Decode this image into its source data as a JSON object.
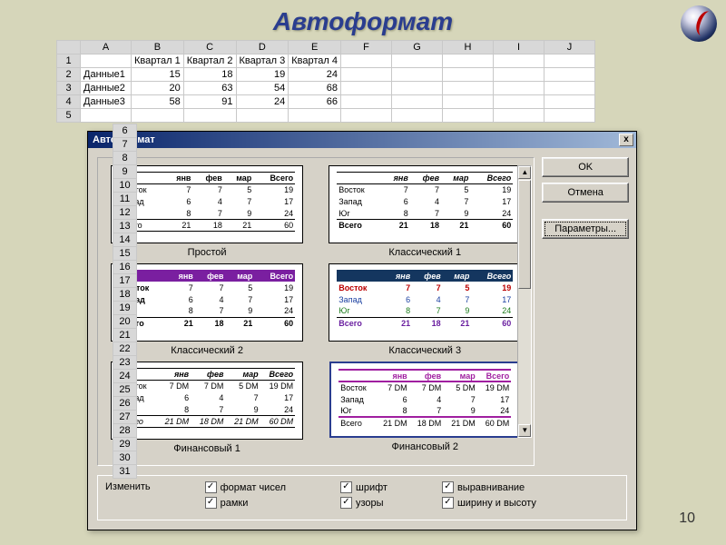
{
  "slide": {
    "title": "Автоформат",
    "number": "10"
  },
  "sheet": {
    "cols": [
      "A",
      "B",
      "C",
      "D",
      "E",
      "F",
      "G",
      "H",
      "I",
      "J"
    ],
    "row1": {
      "a": "",
      "b": "Квартал 1",
      "c": "Квартал 2",
      "d": "Квартал 3",
      "e": "Квартал 4"
    },
    "row2": {
      "a": "Данные1",
      "b": "15",
      "c": "18",
      "d": "19",
      "e": "24"
    },
    "row3": {
      "a": "Данные2",
      "b": "20",
      "c": "63",
      "d": "54",
      "e": "68"
    },
    "row4": {
      "a": "Данные3",
      "b": "58",
      "c": "91",
      "d": "24",
      "e": "66"
    }
  },
  "dialog": {
    "title": "Автоформат",
    "buttons": {
      "ok": "OK",
      "cancel": "Отмена",
      "params": "Параметры..."
    },
    "styles": {
      "s1": "Простой",
      "s2": "Классический 1",
      "s3": "Классический 2",
      "s4": "Классический 3",
      "s5": "Финансовый 1",
      "s6": "Финансовый 2"
    },
    "mini": {
      "hdr": {
        "c1": "янв",
        "c2": "фев",
        "c3": "мар",
        "c4": "Всего"
      },
      "r1": {
        "lbl": "Восток",
        "c1": "7",
        "c2": "7",
        "c3": "5",
        "c4": "19"
      },
      "r2": {
        "lbl": "Запад",
        "c1": "6",
        "c2": "4",
        "c3": "7",
        "c4": "17"
      },
      "r3": {
        "lbl": "Юг",
        "c1": "8",
        "c2": "7",
        "c3": "9",
        "c4": "24"
      },
      "tot": {
        "lbl": "Всего",
        "c1": "21",
        "c2": "18",
        "c3": "21",
        "c4": "60"
      }
    },
    "mini_dm": {
      "r1": {
        "c1": "7 DM",
        "c2": "7 DM",
        "c3": "5 DM",
        "c4": "19 DM"
      },
      "r2": {
        "c1": "6",
        "c2": "4",
        "c3": "7",
        "c4": "17"
      },
      "r3": {
        "c1": "8",
        "c2": "7",
        "c3": "9",
        "c4": "24"
      },
      "tot": {
        "c1": "21 DM",
        "c2": "18 DM",
        "c3": "21 DM",
        "c4": "60 DM"
      }
    },
    "change": {
      "legend": "Изменить",
      "c1": "формат чисел",
      "c2": "рамки",
      "c3": "шрифт",
      "c4": "узоры",
      "c5": "выравнивание",
      "c6": "ширину и высоту"
    }
  }
}
